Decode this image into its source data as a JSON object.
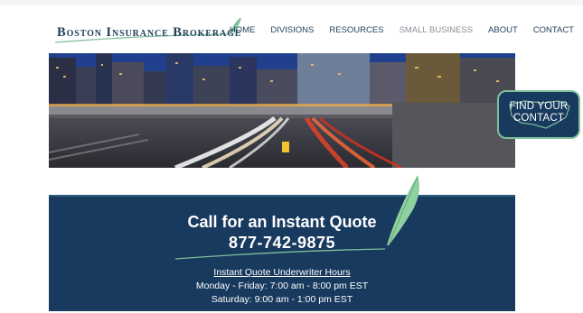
{
  "brand": {
    "name": "Boston Insurance Brokerage"
  },
  "nav": {
    "items": [
      {
        "label": "HOME"
      },
      {
        "label": "DIVISIONS"
      },
      {
        "label": "RESOURCES"
      },
      {
        "label": "SMALL BUSINESS"
      },
      {
        "label": "ABOUT"
      },
      {
        "label": "CONTACT"
      }
    ]
  },
  "find_contact": {
    "line1": "FIND YOUR",
    "line2": "CONTACT"
  },
  "quote": {
    "title": "Call for an Instant Quote",
    "phone": "877-742-9875",
    "hours_title": "Instant Quote Underwriter Hours",
    "weekday": "Monday - Friday: 7:00 am - 8:00 pm EST",
    "saturday": "Saturday: 9:00 am - 1:00 pm EST"
  },
  "colors": {
    "navy": "#183a5e",
    "accent_green": "#7fbf9a"
  }
}
